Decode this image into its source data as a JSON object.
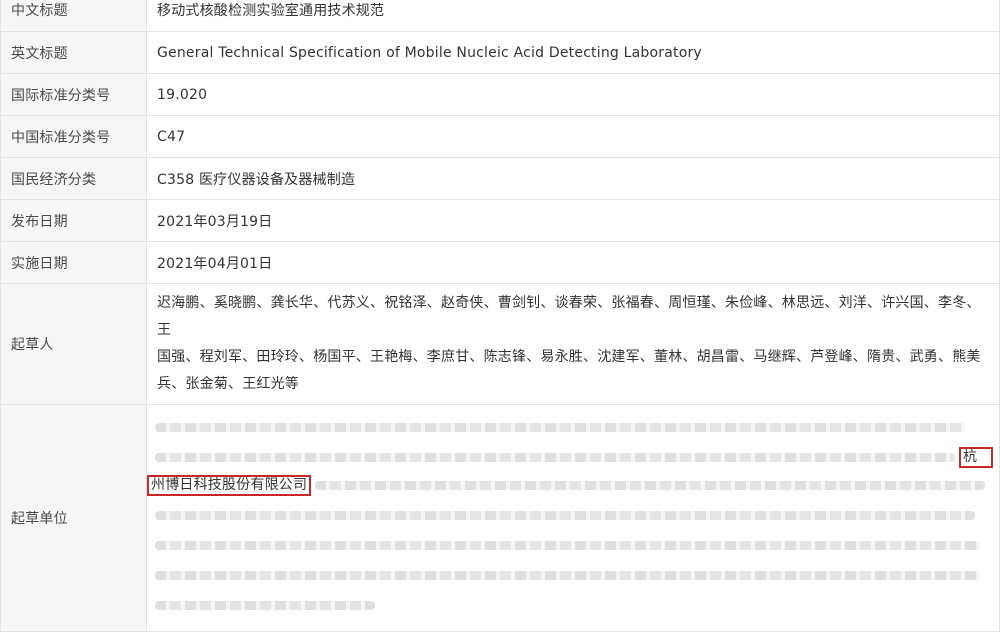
{
  "rows": [
    {
      "label": "中文标题",
      "value": "移动式核酸检测实验室通用技术规范"
    },
    {
      "label": "英文标题",
      "value": "General Technical Specification of Mobile Nucleic Acid Detecting Laboratory"
    },
    {
      "label": "国际标准分类号",
      "value": "19.020"
    },
    {
      "label": "中国标准分类号",
      "value": "C47"
    },
    {
      "label": "国民经济分类",
      "value": "C358 医疗仪器设备及器械制造"
    },
    {
      "label": "发布日期",
      "value": "2021年03月19日"
    },
    {
      "label": "实施日期",
      "value": "2021年04月01日"
    }
  ],
  "drafters": {
    "label": "起草人",
    "lines": [
      "迟海鹏、奚晓鹏、龚长华、代苏义、祝铭泽、赵奇侠、曹剑钊、谈春荣、张福春、周恒瑾、朱俭峰、林思远、刘洋、许兴国、李冬、王",
      "国强、程刘军、田玲玲、杨国平、王艳梅、李庶甘、陈志锋、易永胜、沈建军、董林、胡昌雷、马继辉、芦登峰、隋贵、武勇、熊美",
      "兵、张金菊、王红光等"
    ]
  },
  "units": {
    "label": "起草单位",
    "highlight_part1": "杭",
    "highlight_part2": "州博日科技股份有限公司"
  }
}
